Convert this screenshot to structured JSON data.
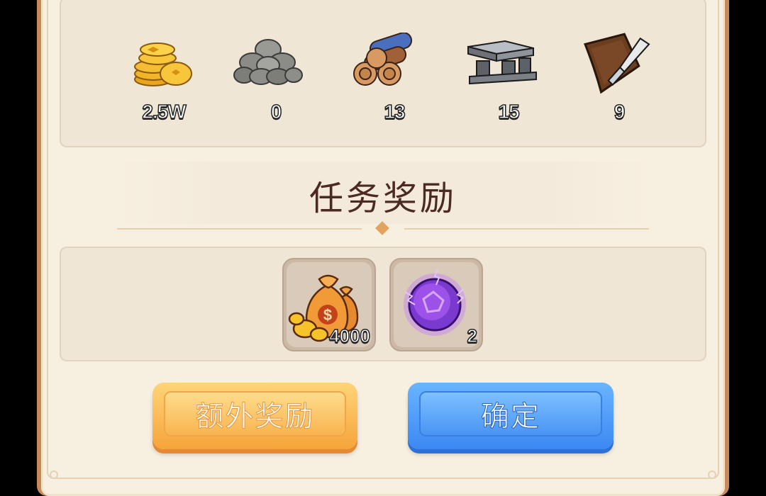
{
  "resources": [
    {
      "name": "gold-coins",
      "value": "2.5W"
    },
    {
      "name": "stone",
      "value": "0"
    },
    {
      "name": "wood",
      "value": "13"
    },
    {
      "name": "iron",
      "value": "15"
    },
    {
      "name": "leather",
      "value": "9"
    }
  ],
  "section_title": "任务奖励",
  "rewards": [
    {
      "icon": "money-bag-icon",
      "count": "4000"
    },
    {
      "icon": "purple-orb-icon",
      "count": "2"
    }
  ],
  "buttons": {
    "extra_label": "额外奖励",
    "confirm_label": "确定"
  },
  "colors": {
    "frame": "#c88a5a",
    "background": "#f7efe0",
    "title": "#4a2a22",
    "extra_button": "#f6a43a",
    "confirm_button": "#3c88f2"
  }
}
